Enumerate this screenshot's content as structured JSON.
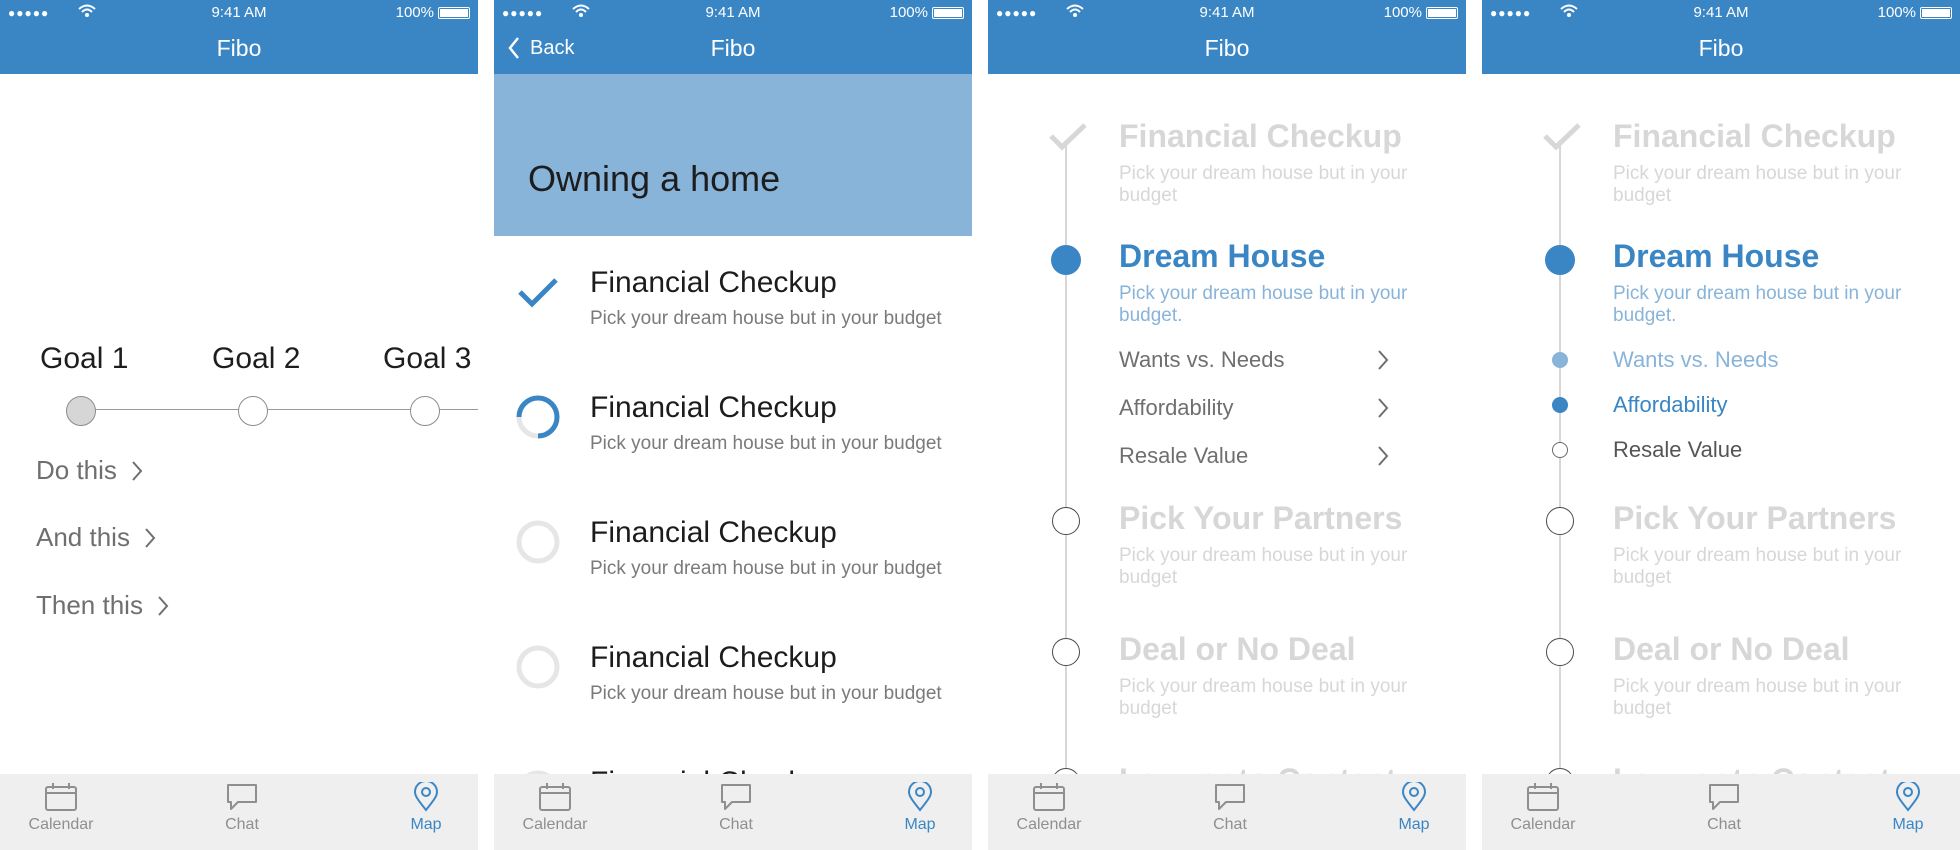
{
  "status": {
    "dots": "●●●●●",
    "time": "9:41 AM",
    "battery": "100%"
  },
  "app": {
    "title": "Fibo",
    "back_label": "Back"
  },
  "tabs": {
    "calendar": "Calendar",
    "chat": "Chat",
    "map": "Map"
  },
  "screen1": {
    "goals": [
      "Goal 1",
      "Goal 2",
      "Goal 3"
    ],
    "actions": [
      "Do this",
      "And this",
      "Then this"
    ]
  },
  "screen2": {
    "heading": "Owning a home",
    "tasks": [
      {
        "title": "Financial Checkup",
        "subtitle": "Pick your dream house but in your budget",
        "state": "done"
      },
      {
        "title": "Financial Checkup",
        "subtitle": "Pick your dream house but in your budget",
        "state": "in-progress"
      },
      {
        "title": "Financial Checkup",
        "subtitle": "Pick your dream house but in your budget",
        "state": "todo"
      },
      {
        "title": "Financial Checkup",
        "subtitle": "Pick your dream house but in your budget",
        "state": "todo"
      },
      {
        "title": "Financial Checkup",
        "subtitle": "",
        "state": "todo"
      }
    ]
  },
  "timeline": {
    "steps": [
      {
        "title": "Financial Checkup",
        "subtitle": "Pick your dream house but in your budget"
      },
      {
        "title": "Dream House",
        "subtitle": "Pick your dream house but in your budget."
      },
      {
        "title": "Pick Your Partners",
        "subtitle": "Pick your dream house but in your budget"
      },
      {
        "title": "Deal or No Deal",
        "subtitle": "Pick your dream house but in your budget"
      },
      {
        "title": "Lawyer to Contact",
        "subtitle": ""
      }
    ],
    "substeps": [
      "Wants vs. Needs",
      "Affordability",
      "Resale Value"
    ]
  },
  "colors": {
    "primary": "#3a86c5",
    "light": "#88b4da",
    "muted": "#d7d7d7",
    "tabbar": "#efefef"
  }
}
